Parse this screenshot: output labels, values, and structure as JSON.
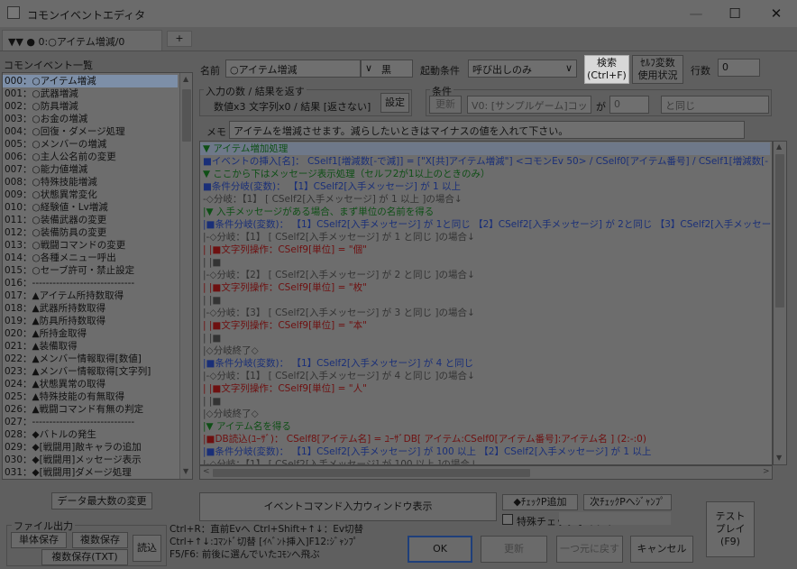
{
  "window": {
    "title": "コモンイベントエディタ",
    "minimize": "—",
    "maximize": "☐",
    "close": "✕"
  },
  "tab": {
    "label": "▼▼ ● 0:○アイテム増減/0",
    "add_label": "+"
  },
  "list": {
    "heading": "コモンイベント一覧",
    "items": [
      "000：○アイテム増減",
      "001：○武器増減",
      "002：○防具増減",
      "003：○お金の増減",
      "004：○回復・ダメージ処理",
      "005：○メンバーの増減",
      "006：○主人公名前の変更",
      "007：○能力値増減",
      "008：○特殊技能増減",
      "009：○状態異常変化",
      "010：○経験値・Lv増減",
      "011：○装備武器の変更",
      "012：○装備防具の変更",
      "013：○戦闘コマンドの変更",
      "014：○各種メニュー呼出",
      "015：○セーブ許可・禁止設定",
      "016：------------------------------",
      "017：▲アイテム所持数取得",
      "018：▲武器所持数取得",
      "019：▲防具所持数取得",
      "020：▲所持金取得",
      "021：▲装備取得",
      "022：▲メンバー情報取得[数値]",
      "023：▲メンバー情報取得[文字列]",
      "024：▲状態異常の取得",
      "025：▲特殊技能の有無取得",
      "026：▲戦闘コマンド有無の判定",
      "027：------------------------------",
      "028：◆バトルの発生",
      "029：◆[戦闘用]敵キャラの追加",
      "030：◆[戦闘用]メッセージ表示",
      "031：◆[戦闘用]ダメージ処理"
    ]
  },
  "form": {
    "name_label": "名前",
    "name_value": "○アイテム増減",
    "color_value": "黒",
    "trigger_label": "起動条件",
    "trigger_value": "呼び出しのみ",
    "search_button": "検索\n(Ctrl+F)",
    "selfvar_button": "ｾﾙﾌ変数\n使用状況",
    "rows_label": "行数",
    "rows_value": "0",
    "io_group_label": "入力の数 / 結果を返す",
    "io_summary": "数値x3 文字列x0 / 結果 [返さない]",
    "io_set_button": "設定",
    "cond_group_label": "条件",
    "cond_update_button": "更新",
    "cond_var_value": "V0: [サンプルゲーム]コッ",
    "cond_ga": "が",
    "cond_num_value": "0",
    "cond_op_value": "と同じ",
    "memo_label": "メモ",
    "memo_value": "アイテムを増減させます。減らしたいときはマイナスの値を入れて下さい。"
  },
  "code_lines": [
    {
      "t": "▼ アイテム増加処理",
      "c": "green",
      "hl": true
    },
    {
      "t": "■イベントの挿入[名]： CSelf1[増減数[-で減]] = [\"X[共]アイテム増減\"] <コモンEv 50>  / CSelf0[アイテム番号] / CSelf1[増減数[-",
      "c": "blue"
    },
    {
      "t": "▼ ここから下はメッセージ表示処理（セルフ2が1以上のときのみ）",
      "c": "green"
    },
    {
      "t": "■条件分岐(変数)： 【1】CSelf2[入手メッセージ]  が   1  以上",
      "c": "blue"
    },
    {
      "t": "-◇分岐：【1】 [ CSelf2[入手メッセージ]  が  1 以上  ]の場合↓",
      "c": "gray"
    },
    {
      "t": "|▼ 入手メッセージがある場合、まず単位の名前を得る",
      "c": "green"
    },
    {
      "t": "|■条件分岐(変数)： 【1】CSelf2[入手メッセージ]  が   1と同じ  【2】CSelf2[入手メッセージ]  が   2と同じ  【3】CSelf2[入手メッセー",
      "c": "blue"
    },
    {
      "t": "|-◇分岐：【1】 [ CSelf2[入手メッセージ]  が  1 と同じ  ]の場合↓",
      "c": "gray"
    },
    {
      "t": "| |■文字列操作：CSelf9[単位] = \"個\"",
      "c": "red"
    },
    {
      "t": "| |■",
      "c": "gray"
    },
    {
      "t": "|-◇分岐：【2】 [ CSelf2[入手メッセージ]  が  2 と同じ  ]の場合↓",
      "c": "gray"
    },
    {
      "t": "| |■文字列操作：CSelf9[単位] = \"枚\"",
      "c": "red"
    },
    {
      "t": "| |■",
      "c": "gray"
    },
    {
      "t": "|-◇分岐：【3】 [ CSelf2[入手メッセージ]  が  3 と同じ  ]の場合↓",
      "c": "gray"
    },
    {
      "t": "| |■文字列操作：CSelf9[単位] = \"本\"",
      "c": "red"
    },
    {
      "t": "| |■",
      "c": "gray"
    },
    {
      "t": "|◇分岐終了◇",
      "c": "gray"
    },
    {
      "t": "|■条件分岐(変数)： 【1】CSelf2[入手メッセージ]  が   4 と同じ",
      "c": "blue"
    },
    {
      "t": "|-◇分岐：【1】 [ CSelf2[入手メッセージ]  が  4 と同じ  ]の場合↓",
      "c": "gray"
    },
    {
      "t": "| |■文字列操作：CSelf9[単位] = \"人\"",
      "c": "red"
    },
    {
      "t": "| |■",
      "c": "gray"
    },
    {
      "t": "|◇分岐終了◇",
      "c": "gray"
    },
    {
      "t": "|▼ アイテム名を得る",
      "c": "green"
    },
    {
      "t": "|■DB読込(ﾕｰｻﾞ)： CSelf8[アイテム名] = ﾕｰｻﾞDB[ アイテム:CSelf0[アイテム番号]:アイテム名 ] (2:-:0)",
      "c": "red"
    },
    {
      "t": "|■条件分岐(変数)： 【1】CSelf2[入手メッセージ]  が   100 以上  【2】CSelf2[入手メッセージ]  が   1 以上",
      "c": "blue"
    },
    {
      "t": "|-◇分岐：【1】 [ CSelf2[入手メッセージ]  が  100 以上  ]の場合↓",
      "c": "gray"
    }
  ],
  "buttons": {
    "data_max": "データ最大数の変更",
    "cmd_window": "イベントコマンド入力ウィンドウ表示",
    "check_add": "◆ﾁｪｯｸP追加",
    "next_check": "次ﾁｪｯｸPへｼﾞｬﾝﾌﾟ",
    "special_check": "特殊チェックポイント",
    "test_play": "テスト\nプレイ\n(F9)",
    "ok": "OK",
    "update": "更新",
    "undo": "一つ元に戻す",
    "cancel": "キャンセル",
    "file_group": "ファイル出力",
    "single_save": "単体保存",
    "multi_save": "複数保存",
    "multi_save_txt": "複数保存(TXT)",
    "load": "読込"
  },
  "shortcuts": [
    "Ctrl+R：直前Evへ  Ctrl+Shift+↑↓：Ev切替",
    "Ctrl+↑↓:ｺﾏﾝﾄﾞ切替 [ｲﾍﾞﾝﾄ挿入]F12:ｼﾞｬﾝﾌﾟ",
    "F5/F6: 前後に選んでいたｺﾓﾝへ飛ぶ"
  ]
}
